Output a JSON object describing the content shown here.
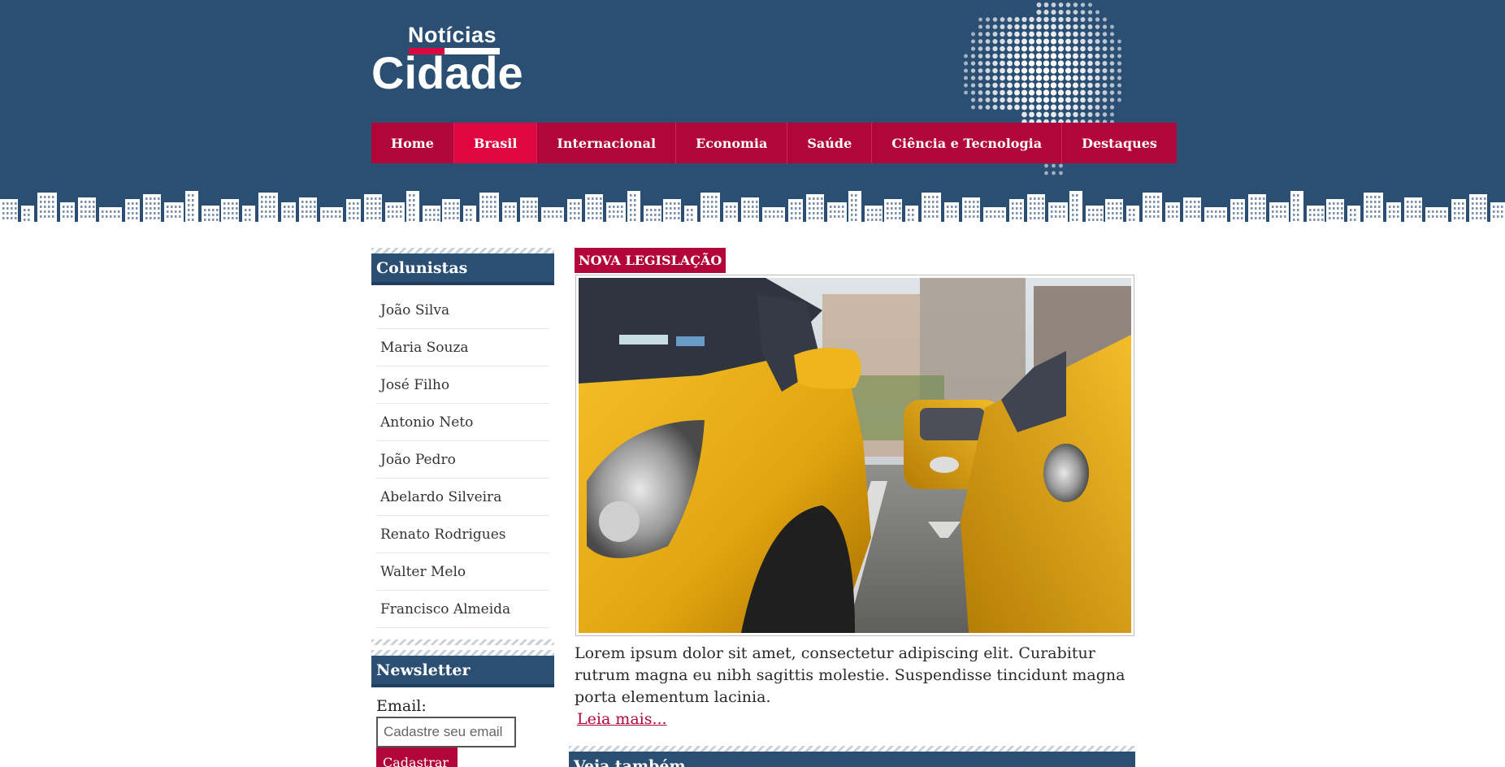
{
  "logo": {
    "top": "Notícias",
    "main": "Cidade"
  },
  "nav": {
    "items": [
      {
        "label": "Home",
        "active": false
      },
      {
        "label": "Brasil",
        "active": true
      },
      {
        "label": "Internacional",
        "active": false
      },
      {
        "label": "Economia",
        "active": false
      },
      {
        "label": "Saúde",
        "active": false
      },
      {
        "label": "Ciência e Tecnologia",
        "active": false
      },
      {
        "label": "Destaques",
        "active": false
      }
    ]
  },
  "sidebar": {
    "columnists_title": "Colunistas",
    "columnists": [
      "João Silva",
      "Maria Souza",
      "José Filho",
      "Antonio Neto",
      "João Pedro",
      "Abelardo Silveira",
      "Renato Rodrigues",
      "Walter Melo",
      "Francisco Almeida"
    ],
    "newsletter_title": "Newsletter",
    "email_label": "Email:",
    "email_placeholder": "Cadastre seu email",
    "submit_label": "Cadastrar"
  },
  "article": {
    "tag": "NOVA LEGISLAÇÃO",
    "excerpt": "Lorem ipsum dolor sit amet, consectetur adipiscing elit. Curabitur rutrum magna eu nibh sagittis molestie. Suspendisse tincidunt magna porta elementum lacinia.",
    "read_more": "Leia mais..."
  },
  "see_also": {
    "title": "Veja também"
  },
  "colors": {
    "header_blue": "#2b4e73",
    "nav_red": "#b2063a",
    "nav_active": "#e0063f",
    "link_red": "#b2063a"
  },
  "icons": {
    "map": "brazil-dot-map",
    "skyline": "city-skyline"
  }
}
